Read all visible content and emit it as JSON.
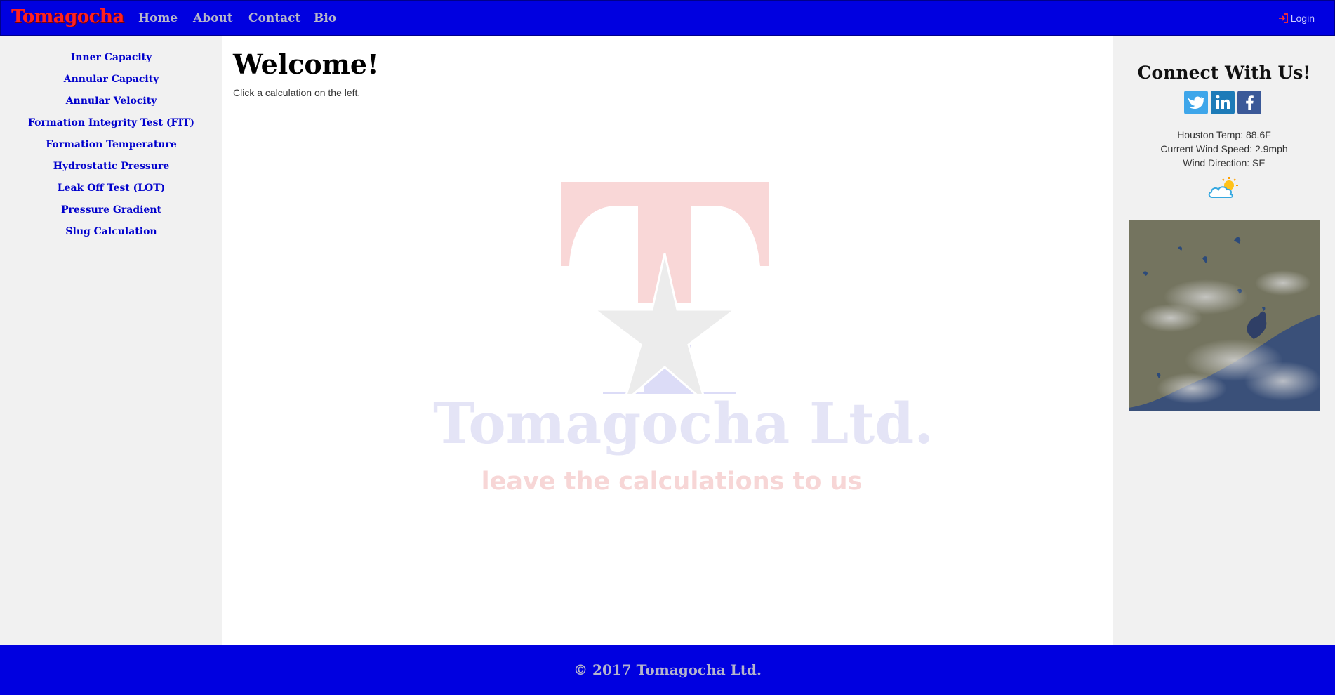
{
  "nav": {
    "brand": "Tomagocha",
    "links": [
      "Home",
      "About",
      "Contact",
      "Bio"
    ],
    "login": "Login"
  },
  "sidebar": {
    "links": [
      "Inner Capacity",
      "Annular Capacity",
      "Annular Velocity",
      "Formation Integrity Test (FIT)",
      "Formation Temperature",
      "Hydrostatic Pressure",
      "Leak Off Test (LOT)",
      "Pressure Gradient",
      "Slug Calculation"
    ]
  },
  "main": {
    "title": "Welcome!",
    "hint": "Click a calculation on the left.",
    "logo": {
      "company": "Tomagocha Ltd.",
      "tagline": "leave the calculations to us"
    }
  },
  "right": {
    "connect_title": "Connect With Us!",
    "social": [
      "twitter-icon",
      "linkedin-icon",
      "facebook-icon"
    ],
    "weather": {
      "temp": "Houston Temp: 88.6F",
      "wind_speed": "Current Wind Speed: 2.9mph",
      "wind_direction": "Wind Direction: SE",
      "icon": "partly-cloudy-icon"
    }
  },
  "footer": {
    "text": "© 2017 Tomagocha Ltd."
  },
  "colors": {
    "nav_bg": "#0000e0",
    "brand": "#ff2020",
    "link": "#0000cc",
    "page_bg": "#f1f1f1"
  }
}
